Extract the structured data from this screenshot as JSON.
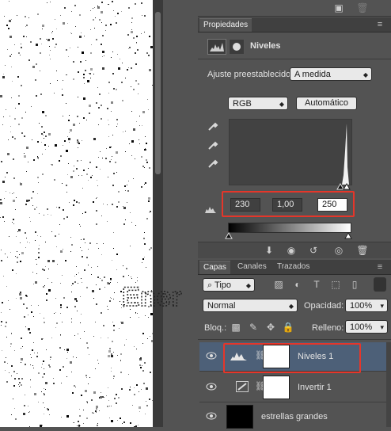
{
  "properties_panel": {
    "title": "Propiedades",
    "adjustment_name": "Niveles",
    "preset_label": "Ajuste preestablecido:",
    "preset_value": "A medida",
    "channel_value": "RGB",
    "auto_button": "Automático",
    "input_black": "230",
    "input_gamma": "1,00",
    "input_white": "250"
  },
  "layers_panel": {
    "tabs": [
      "Capas",
      "Canales",
      "Trazados"
    ],
    "filter_kind": "Tipo",
    "blend_mode": "Normal",
    "opacity_label": "Opacidad:",
    "opacity_value": "100%",
    "lock_label": "Bloq.:",
    "fill_label": "Relleno:",
    "fill_value": "100%",
    "layers": [
      {
        "name": "Niveles 1"
      },
      {
        "name": "Invertir 1"
      },
      {
        "name": "estrellas grandes"
      }
    ]
  },
  "canvas_text": "Ener",
  "colors": {
    "highlight": "#e5362a",
    "panel_bg": "#535353",
    "selected_row": "#4d6078"
  }
}
